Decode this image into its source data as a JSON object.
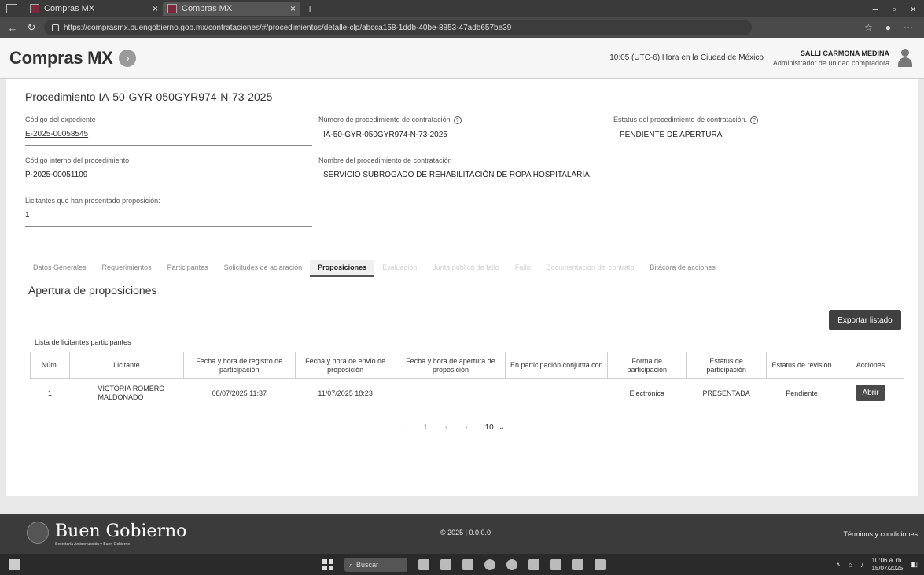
{
  "browser": {
    "tabs": [
      {
        "title": "Compras MX"
      },
      {
        "title": "Compras MX"
      }
    ],
    "url": "https://comprasmx.buengobierno.gob.mx/contrataciones/#/procedimientos/detalle-clp/abcca158-1ddb-40be-8853-47adb657be39"
  },
  "header": {
    "logo_text": "Compras",
    "logo_mark": "MX",
    "clock": "10:05 (UTC-6) Hora en la Ciudad de México",
    "user_name": "SALLI CARMONA MEDINA",
    "user_role": "Administrador de unidad compradora"
  },
  "procedure": {
    "title": "Procedimiento IA-50-GYR-050GYR974-N-73-2025",
    "fields": {
      "expediente_label": "Código del expediente",
      "expediente_value": "E-2025-00058545",
      "numero_label": "Número de procedimiento de contratación",
      "numero_value": "IA-50-GYR-050GYR974-N-73-2025",
      "estatus_label": "Estatus del procedimiento de contratación.",
      "estatus_value": "PENDIENTE DE APERTURA",
      "interno_label": "Código interno del procedimiento",
      "interno_value": "P-2025-00051109",
      "nombre_label": "Nombre del procedimiento de contratación",
      "nombre_value": "SERVICIO SUBROGADO DE REHABILITACIÓN DE ROPA HOSPITALARIA",
      "licitantes_label": "Licitantes que han presentado proposición:",
      "licitantes_value": "1"
    }
  },
  "tabs": [
    {
      "label": "Datos Generales"
    },
    {
      "label": "Requerimientos"
    },
    {
      "label": "Participantes"
    },
    {
      "label": "Solicitudes de aclaración"
    },
    {
      "label": "Proposiciones"
    },
    {
      "label": "Evaluación"
    },
    {
      "label": "Junta pública de fallo"
    },
    {
      "label": "Fallo"
    },
    {
      "label": "Documentación del contrato"
    },
    {
      "label": "Bitácora de acciones"
    }
  ],
  "section": {
    "title": "Apertura de proposiciones",
    "export_label": "Exportar listado",
    "list_label": "Lista de licitantes participantes"
  },
  "table": {
    "headers": [
      "Núm.",
      "Licitante",
      "Fecha y hora de registro de participación",
      "Fecha y hora de envío de proposición",
      "Fecha y hora de apertura de proposición",
      "En participación conjunta con",
      "Forma de participación",
      "Estatus de participación",
      "Estatus de revisión",
      "Acciones"
    ],
    "rows": [
      {
        "num": "1",
        "licitante": "VICTORIA ROMERO MALDONADO",
        "registro": "08/07/2025 11:37",
        "envio": "11/07/2025 18:23",
        "apertura": "",
        "conjunta": "",
        "forma": "Electrónica",
        "estatus": "PRESENTADA",
        "revision": "Pendiente",
        "accion": "Abrir"
      }
    ]
  },
  "pager": {
    "prev": "...",
    "page": "1",
    "page_size": "10"
  },
  "footer": {
    "brand": "Buen Gobierno",
    "brand_sub": "Secretaría Anticorrupción y Buen Gobierno",
    "copyright": "© 2025 | 0.0.0.0",
    "terms": "Términos y condiciones"
  },
  "taskbar": {
    "search": "Buscar",
    "time": "10:06 a. m.",
    "date": "15/07/2025"
  }
}
